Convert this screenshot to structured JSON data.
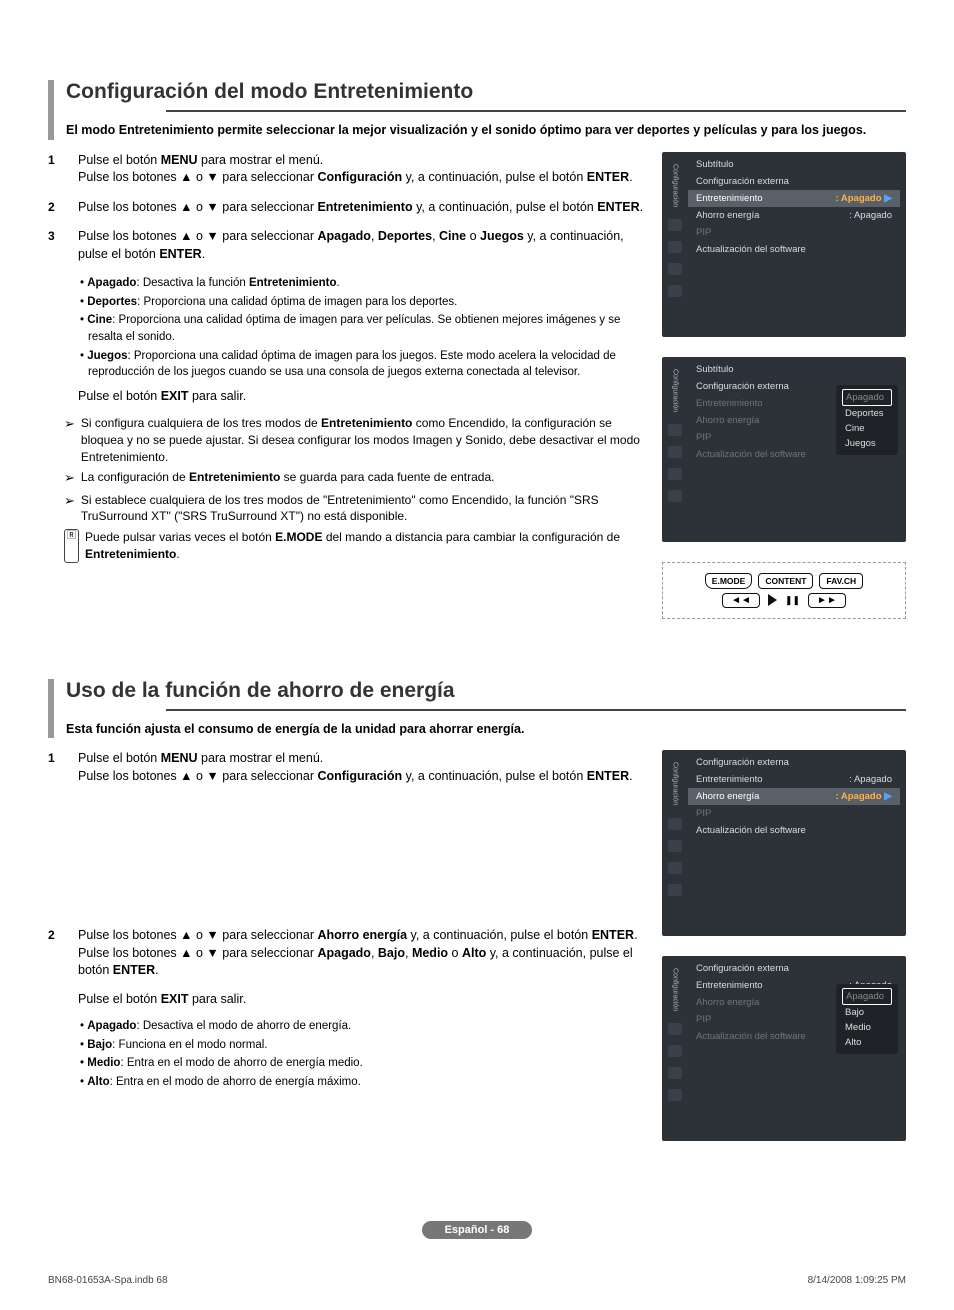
{
  "section1": {
    "title": "Configuración del modo Entretenimiento",
    "intro": "El modo Entretenimiento permite seleccionar la mejor visualización y el sonido óptimo para ver deportes y películas y para los juegos.",
    "steps": [
      {
        "num": "1",
        "html": "Pulse el botón <b>MENU</b> para mostrar el menú.<br>Pulse los botones ▲ o ▼ para seleccionar <b>Configuración</b> y, a continuación, pulse el botón <b>ENTER</b>."
      },
      {
        "num": "2",
        "html": "Pulse los botones ▲ o ▼ para seleccionar <b>Entretenimiento</b> y, a continuación, pulse el botón <b>ENTER</b>."
      },
      {
        "num": "3",
        "html": "Pulse los botones ▲ o ▼ para seleccionar <b>Apagado</b>, <b>Deportes</b>, <b>Cine</b> o <b>Juegos</b> y, a continuación, pulse el botón <b>ENTER</b>."
      }
    ],
    "bullets": [
      "<b>Apagado</b>: Desactiva la función <b>Entretenimiento</b>.",
      "<b>Deportes</b>: Proporciona una calidad óptima de imagen para los deportes.",
      "<b>Cine</b>: Proporciona una calidad óptima de imagen para ver películas. Se obtienen mejores imágenes y se resalta el sonido.",
      "<b>Juegos</b>: Proporciona una calidad óptima de imagen para los juegos. Este modo acelera la velocidad de reproducción de los juegos cuando se usa una consola de juegos externa conectada al televisor."
    ],
    "exit": "Pulse el botón <b>EXIT</b> para salir.",
    "notes": [
      "Si configura cualquiera de los tres modos de <b>Entretenimiento</b> como Encendido, la configuración se bloquea y no se puede ajustar. Si desea configurar los modos Imagen y Sonido, debe desactivar el modo Entretenimiento.",
      "La configuración de <b>Entretenimiento</b> se guarda para cada fuente de entrada.",
      "Si establece cualquiera de los tres modos de \"Entretenimiento\" como Encendido, la función \"SRS TruSurround XT\" (\"SRS TruSurround XT\") no está disponible."
    ],
    "note_remote": "Puede pulsar varias veces el botón <b>E.MODE</b> del mando a distancia para cambiar la configuración de <b>Entretenimiento</b>."
  },
  "section2": {
    "title": "Uso de la función de ahorro de energía",
    "intro": "Esta función ajusta el consumo de energía de la unidad para ahorrar energía.",
    "steps": [
      {
        "num": "1",
        "html": "Pulse el botón <b>MENU</b> para mostrar el menú.<br>Pulse los botones ▲ o ▼ para seleccionar <b>Configuración</b> y, a continuación, pulse el botón <b>ENTER</b>."
      },
      {
        "num": "2",
        "html": "Pulse los botones ▲ o ▼ para seleccionar <b>Ahorro energía</b> y, a continuación, pulse el botón <b>ENTER</b>.<br>Pulse los botones ▲ o ▼ para seleccionar <b>Apagado</b>, <b>Bajo</b>, <b>Medio</b> o <b>Alto</b> y, a continuación, pulse el botón <b>ENTER</b>."
      }
    ],
    "exit": "Pulse el botón <b>EXIT</b> para salir.",
    "bullets": [
      "<b>Apagado</b>: Desactiva el modo de ahorro de energía.",
      "<b>Bajo</b>: Funciona en el modo normal.",
      "<b>Medio</b>: Entra en el modo de ahorro de energía medio.",
      "<b>Alto</b>: Entra en el modo de ahorro de energía máximo."
    ]
  },
  "osd": {
    "side_label": "Configuración",
    "panel1": {
      "rows": [
        {
          "label": "Subtítulo",
          "val": "",
          "dim": false
        },
        {
          "label": "Configuración externa",
          "val": "",
          "dim": false
        },
        {
          "label": "Entretenimiento",
          "val": ": Apagado",
          "hl": true,
          "arrow": true
        },
        {
          "label": "Ahorro energía",
          "val": ": Apagado",
          "dim": false
        },
        {
          "label": "PIP",
          "val": "",
          "dim": true
        },
        {
          "label": "Actualización del software",
          "val": "",
          "dim": false
        }
      ]
    },
    "panel2": {
      "rows": [
        {
          "label": "Subtítulo",
          "val": ""
        },
        {
          "label": "Configuración externa",
          "val": ""
        },
        {
          "label": "Entretenimiento",
          "val": "",
          "dim": true
        },
        {
          "label": "Ahorro energía",
          "val": "",
          "dim": true
        },
        {
          "label": "PIP",
          "val": "",
          "dim": true
        },
        {
          "label": "Actualización del software",
          "val": "",
          "dim": true
        }
      ],
      "popup": [
        "Apagado",
        "Deportes",
        "Cine",
        "Juegos"
      ]
    },
    "panel3": {
      "rows": [
        {
          "label": "Configuración externa",
          "val": ""
        },
        {
          "label": "Entretenimiento",
          "val": ": Apagado"
        },
        {
          "label": "Ahorro energía",
          "val": ": Apagado",
          "hl": true,
          "arrow": true
        },
        {
          "label": "PIP",
          "val": "",
          "dim": true
        },
        {
          "label": "Actualización del software",
          "val": ""
        }
      ]
    },
    "panel4": {
      "rows": [
        {
          "label": "Configuración externa",
          "val": ""
        },
        {
          "label": "Entretenimiento",
          "val": ": Apagado"
        },
        {
          "label": "Ahorro energía",
          "val": "",
          "dim": true
        },
        {
          "label": "PIP",
          "val": "",
          "dim": true
        },
        {
          "label": "Actualización del software",
          "val": "",
          "dim": true
        }
      ],
      "popup": [
        "Apagado",
        "Bajo",
        "Medio",
        "Alto"
      ]
    }
  },
  "remote": {
    "b1": "E.MODE",
    "b2": "CONTENT",
    "b3": "FAV.CH",
    "rew": "◄◄",
    "fwd": "►►",
    "pause": "❚❚"
  },
  "footer": {
    "badge": "Español - 68",
    "left": "BN68-01653A-Spa.indb   68",
    "right": "8/14/2008   1:09:25 PM"
  }
}
